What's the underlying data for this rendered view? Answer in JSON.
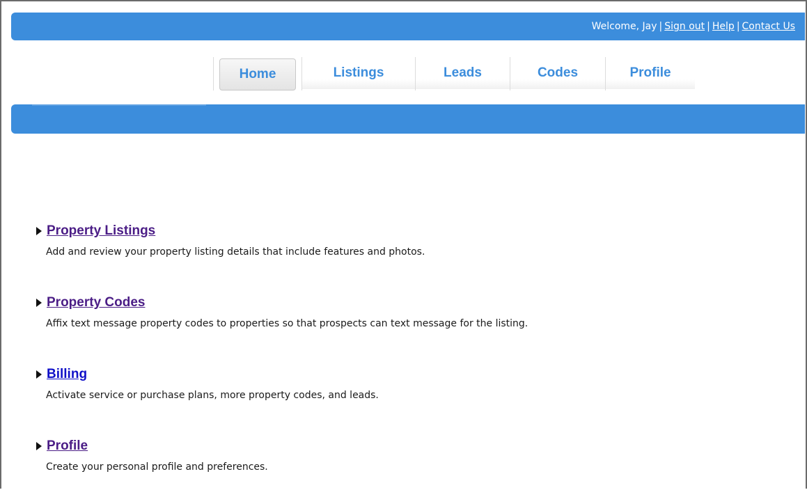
{
  "header": {
    "welcome": "Welcome, Jay",
    "links": [
      {
        "label": "Sign out"
      },
      {
        "label": "Help"
      },
      {
        "label": "Contact Us"
      }
    ],
    "separator": "|"
  },
  "nav": {
    "tabs": [
      {
        "label": "Home",
        "active": true
      },
      {
        "label": "Listings",
        "active": false
      },
      {
        "label": "Leads",
        "active": false
      },
      {
        "label": "Codes",
        "active": false
      },
      {
        "label": "Profile",
        "active": false
      }
    ]
  },
  "sections": [
    {
      "title": "Property Listings",
      "description": "Add and review your property listing details that include features and photos."
    },
    {
      "title": "Property Codes",
      "description": "Affix text message property codes to properties so that prospects can text message for the listing."
    },
    {
      "title": "Billing",
      "description": "Activate service or purchase plans, more property codes, and leads."
    },
    {
      "title": "Profile",
      "description": "Create your personal profile and preferences."
    }
  ],
  "colors": {
    "brand_blue": "#3c8ddc",
    "visited_link": "#4b1d86",
    "unvisited_link": "#1010c8"
  }
}
